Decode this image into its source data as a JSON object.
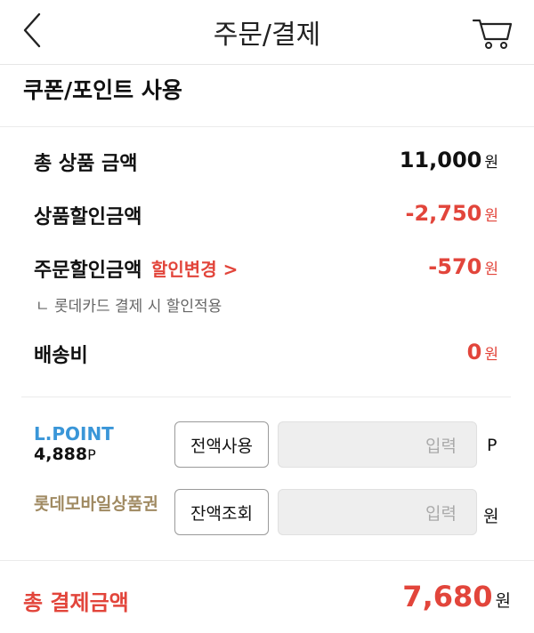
{
  "header": {
    "title": "주문/결제",
    "back_icon": "chevron-left-icon",
    "cart_icon": "cart-icon"
  },
  "coupon_section": {
    "title": "쿠폰/포인트 사용"
  },
  "summary": {
    "total_product": {
      "label": "총 상품 금액",
      "value": "11,000",
      "unit": "원"
    },
    "product_discount": {
      "label": "상품할인금액",
      "value": "-2,750",
      "unit": "원"
    },
    "order_discount": {
      "label": "주문할인금액",
      "change_link": "할인변경 >",
      "value": "-570",
      "unit": "원",
      "note": "ㄴ 롯데카드 결제 시 할인적용"
    },
    "shipping": {
      "label": "배송비",
      "value": "0",
      "unit": "원"
    }
  },
  "lpoint": {
    "name": "L.POINT",
    "balance": "4,888",
    "balance_unit": "P",
    "use_all_label": "전액사용",
    "input_placeholder": "입력",
    "unit": "P"
  },
  "gift_card": {
    "name": "롯데모바일상품권",
    "check_balance_label": "잔액조회",
    "input_placeholder": "입력",
    "unit": "원"
  },
  "total": {
    "label": "총 결제금액",
    "value": "7,680",
    "unit": "원"
  },
  "colors": {
    "accent_red": "#e2453b",
    "lpoint_blue": "#3a96d8",
    "gift_gold": "#a08a62"
  }
}
